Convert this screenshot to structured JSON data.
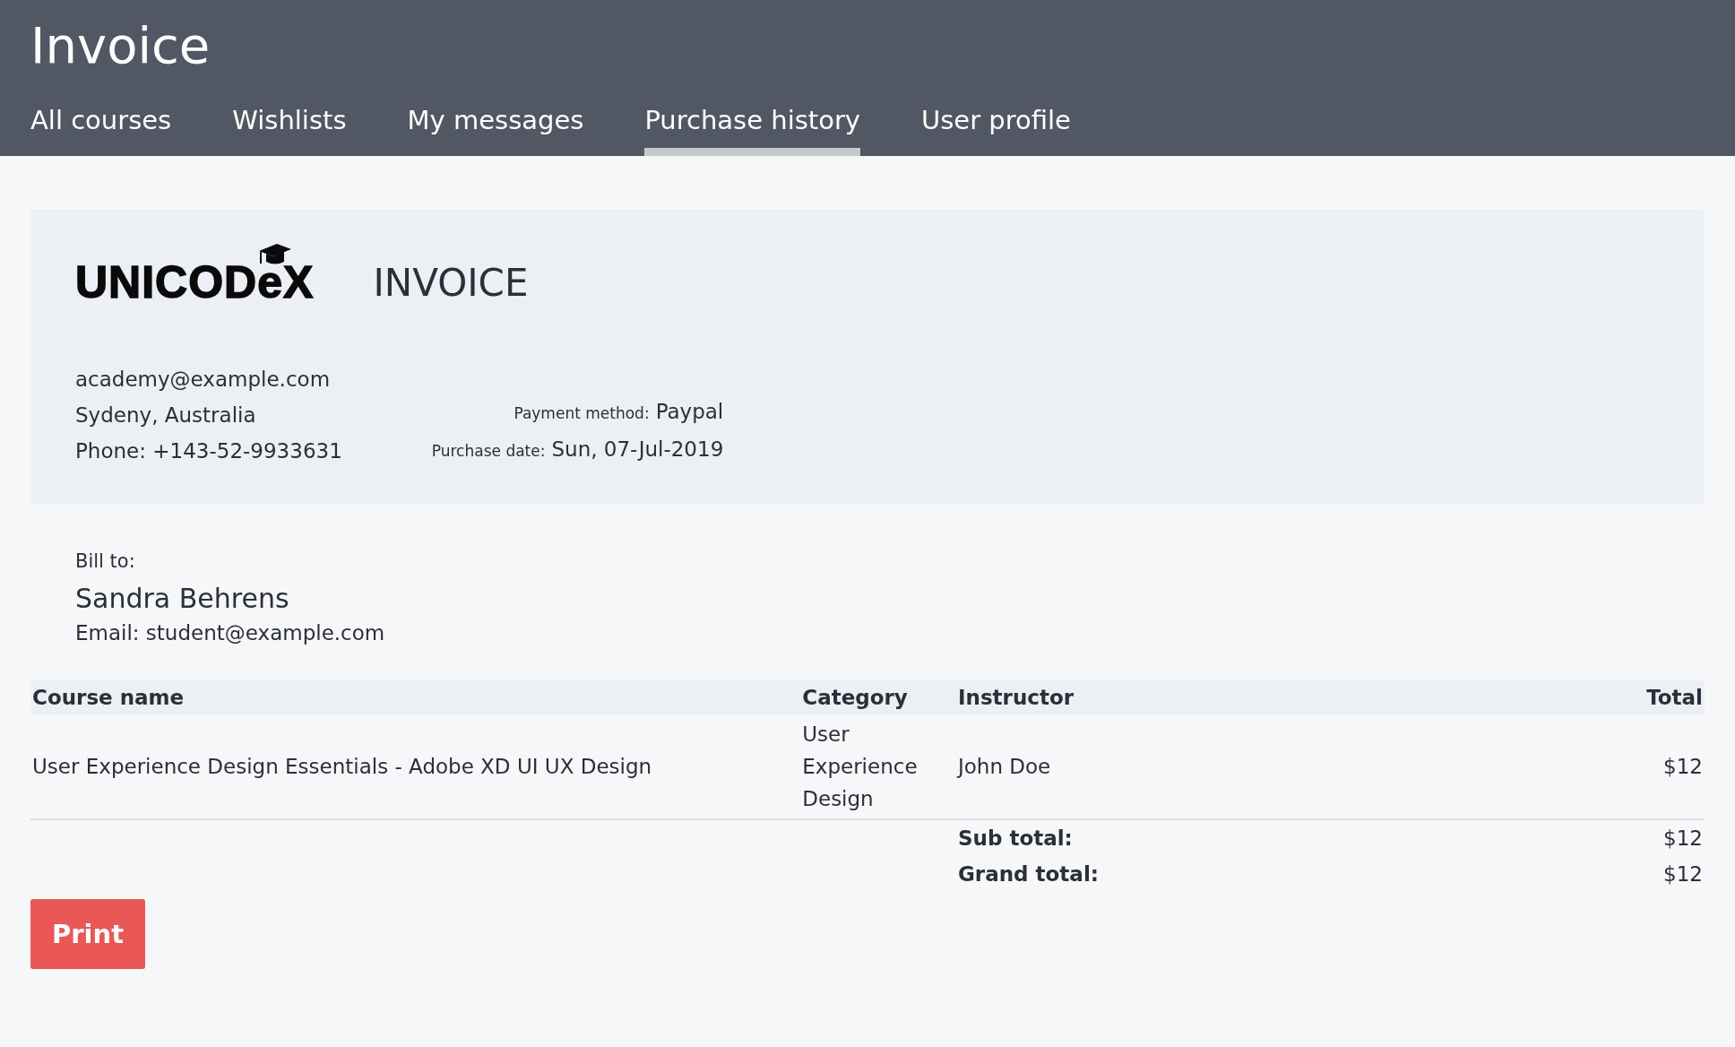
{
  "header": {
    "title": "Invoice"
  },
  "tabs": [
    {
      "label": "All courses",
      "selected": false
    },
    {
      "label": "Wishlists",
      "selected": false
    },
    {
      "label": "My messages",
      "selected": false
    },
    {
      "label": "Purchase history",
      "selected": true
    },
    {
      "label": "User profile",
      "selected": false
    }
  ],
  "invoice": {
    "logo": "UNICODeX",
    "heading": "INVOICE",
    "company_lines": [
      "academy@example.com",
      "Sydeny, Australia",
      "Phone: +143-52-9933631"
    ],
    "details": [
      {
        "label": "Payment method:",
        "value": "Paypal"
      },
      {
        "label": "Purchase date:",
        "value": "Sun, 07-Jul-2019"
      }
    ]
  },
  "bill_to": {
    "label": "Bill to:",
    "name": "Sandra Behrens",
    "email": "Email: student@example.com"
  },
  "table": {
    "columns": [
      "Course name",
      "Category",
      "Instructor",
      "Total"
    ],
    "rows": [
      {
        "cells": [
          "User Experience Design Essentials - Adobe XD UI UX Design",
          "User Experience Design",
          "John Doe",
          "$12"
        ]
      }
    ],
    "summary": [
      {
        "label": "Sub total:",
        "value": "$12"
      },
      {
        "label": "Grand total:",
        "value": "$12"
      }
    ]
  },
  "print_button": "Print"
}
